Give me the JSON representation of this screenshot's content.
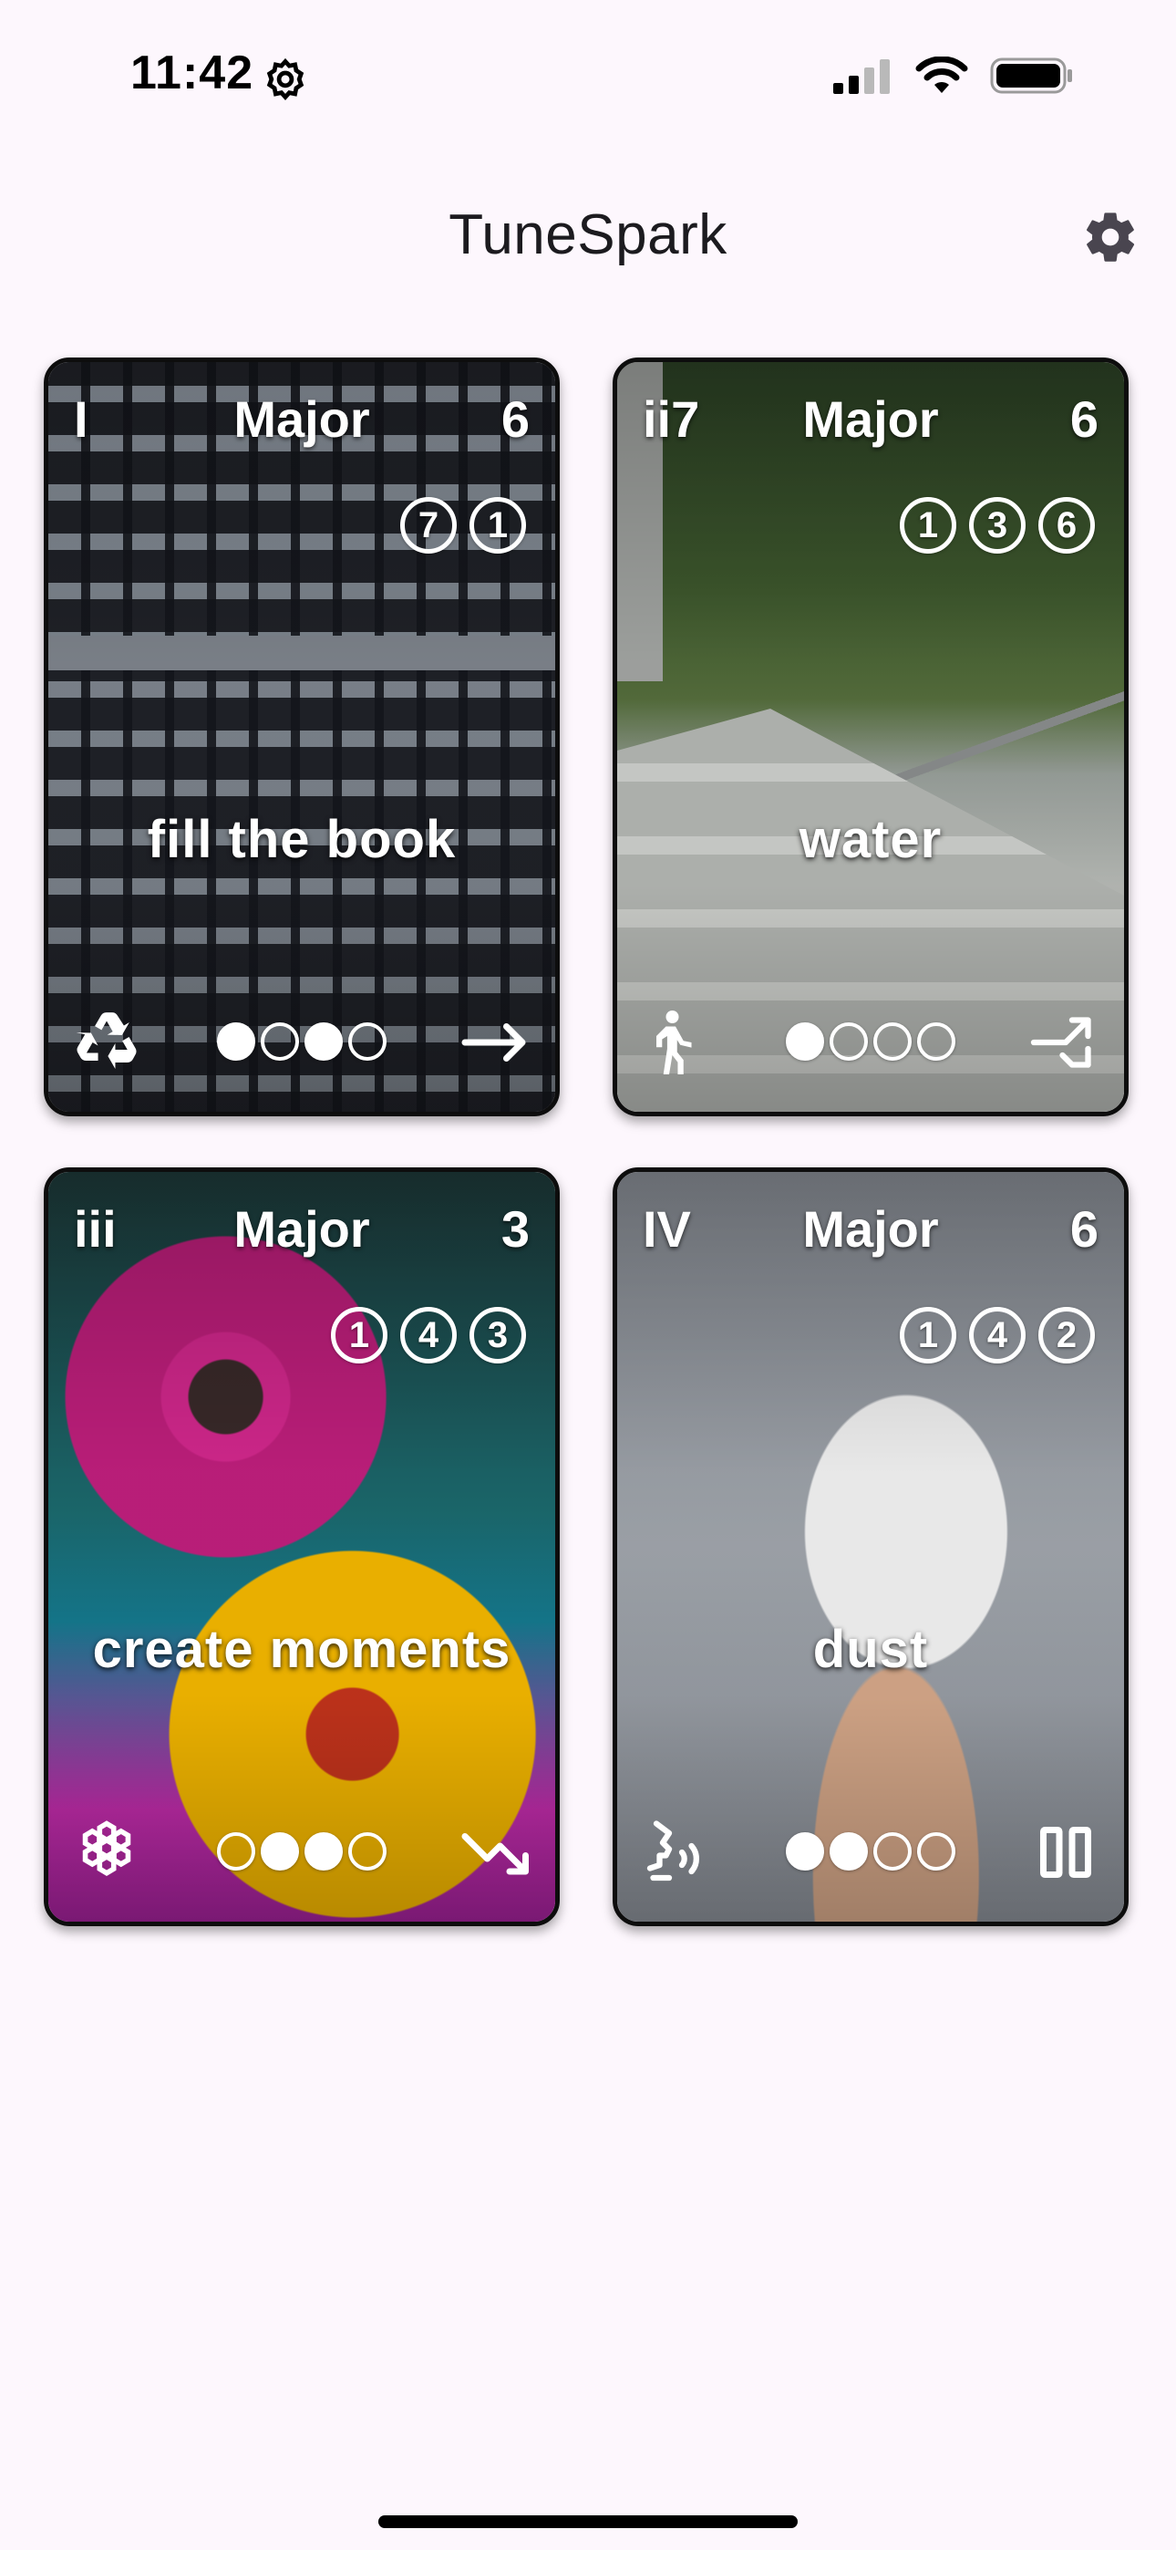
{
  "status_bar": {
    "time": "11:42"
  },
  "app": {
    "title": "TuneSpark"
  },
  "cards": [
    {
      "numeral": "I",
      "mode": "Major",
      "count": "6",
      "degrees": [
        "7",
        "1"
      ],
      "word": "fill the book",
      "dots": [
        true,
        false,
        true,
        false
      ],
      "left_icon": "recycle-icon",
      "right_icon": "arrow-right-icon"
    },
    {
      "numeral": "ii7",
      "mode": "Major",
      "count": "6",
      "degrees": [
        "1",
        "3",
        "6"
      ],
      "word": "water",
      "dots": [
        true,
        false,
        false,
        false
      ],
      "left_icon": "person-walking-icon",
      "right_icon": "shuffle-arrow-icon"
    },
    {
      "numeral": "iii",
      "mode": "Major",
      "count": "3",
      "degrees": [
        "1",
        "4",
        "3"
      ],
      "word": "create moments",
      "dots": [
        false,
        true,
        true,
        false
      ],
      "left_icon": "hexagon-flower-icon",
      "right_icon": "trending-down-icon"
    },
    {
      "numeral": "IV",
      "mode": "Major",
      "count": "6",
      "degrees": [
        "1",
        "4",
        "2"
      ],
      "word": "dust",
      "dots": [
        true,
        true,
        false,
        false
      ],
      "left_icon": "person-speaking-icon",
      "right_icon": "pause-icon"
    }
  ]
}
